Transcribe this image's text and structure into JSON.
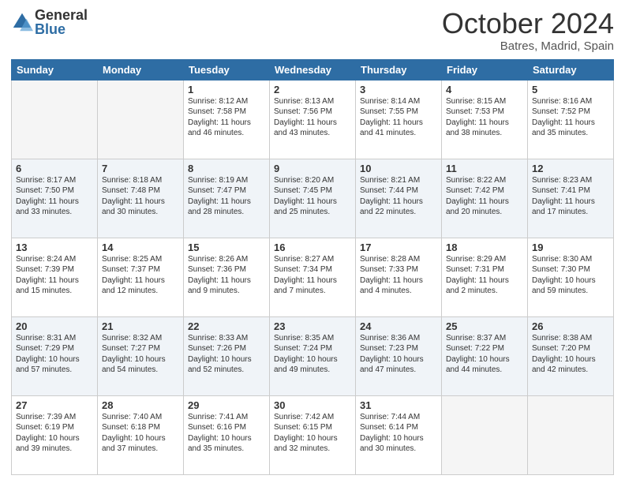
{
  "logo": {
    "general": "General",
    "blue": "Blue"
  },
  "header": {
    "month": "October 2024",
    "location": "Batres, Madrid, Spain"
  },
  "weekdays": [
    "Sunday",
    "Monday",
    "Tuesday",
    "Wednesday",
    "Thursday",
    "Friday",
    "Saturday"
  ],
  "weeks": [
    [
      {
        "day": "",
        "info": ""
      },
      {
        "day": "",
        "info": ""
      },
      {
        "day": "1",
        "info": "Sunrise: 8:12 AM\nSunset: 7:58 PM\nDaylight: 11 hours and 46 minutes."
      },
      {
        "day": "2",
        "info": "Sunrise: 8:13 AM\nSunset: 7:56 PM\nDaylight: 11 hours and 43 minutes."
      },
      {
        "day": "3",
        "info": "Sunrise: 8:14 AM\nSunset: 7:55 PM\nDaylight: 11 hours and 41 minutes."
      },
      {
        "day": "4",
        "info": "Sunrise: 8:15 AM\nSunset: 7:53 PM\nDaylight: 11 hours and 38 minutes."
      },
      {
        "day": "5",
        "info": "Sunrise: 8:16 AM\nSunset: 7:52 PM\nDaylight: 11 hours and 35 minutes."
      }
    ],
    [
      {
        "day": "6",
        "info": "Sunrise: 8:17 AM\nSunset: 7:50 PM\nDaylight: 11 hours and 33 minutes."
      },
      {
        "day": "7",
        "info": "Sunrise: 8:18 AM\nSunset: 7:48 PM\nDaylight: 11 hours and 30 minutes."
      },
      {
        "day": "8",
        "info": "Sunrise: 8:19 AM\nSunset: 7:47 PM\nDaylight: 11 hours and 28 minutes."
      },
      {
        "day": "9",
        "info": "Sunrise: 8:20 AM\nSunset: 7:45 PM\nDaylight: 11 hours and 25 minutes."
      },
      {
        "day": "10",
        "info": "Sunrise: 8:21 AM\nSunset: 7:44 PM\nDaylight: 11 hours and 22 minutes."
      },
      {
        "day": "11",
        "info": "Sunrise: 8:22 AM\nSunset: 7:42 PM\nDaylight: 11 hours and 20 minutes."
      },
      {
        "day": "12",
        "info": "Sunrise: 8:23 AM\nSunset: 7:41 PM\nDaylight: 11 hours and 17 minutes."
      }
    ],
    [
      {
        "day": "13",
        "info": "Sunrise: 8:24 AM\nSunset: 7:39 PM\nDaylight: 11 hours and 15 minutes."
      },
      {
        "day": "14",
        "info": "Sunrise: 8:25 AM\nSunset: 7:37 PM\nDaylight: 11 hours and 12 minutes."
      },
      {
        "day": "15",
        "info": "Sunrise: 8:26 AM\nSunset: 7:36 PM\nDaylight: 11 hours and 9 minutes."
      },
      {
        "day": "16",
        "info": "Sunrise: 8:27 AM\nSunset: 7:34 PM\nDaylight: 11 hours and 7 minutes."
      },
      {
        "day": "17",
        "info": "Sunrise: 8:28 AM\nSunset: 7:33 PM\nDaylight: 11 hours and 4 minutes."
      },
      {
        "day": "18",
        "info": "Sunrise: 8:29 AM\nSunset: 7:31 PM\nDaylight: 11 hours and 2 minutes."
      },
      {
        "day": "19",
        "info": "Sunrise: 8:30 AM\nSunset: 7:30 PM\nDaylight: 10 hours and 59 minutes."
      }
    ],
    [
      {
        "day": "20",
        "info": "Sunrise: 8:31 AM\nSunset: 7:29 PM\nDaylight: 10 hours and 57 minutes."
      },
      {
        "day": "21",
        "info": "Sunrise: 8:32 AM\nSunset: 7:27 PM\nDaylight: 10 hours and 54 minutes."
      },
      {
        "day": "22",
        "info": "Sunrise: 8:33 AM\nSunset: 7:26 PM\nDaylight: 10 hours and 52 minutes."
      },
      {
        "day": "23",
        "info": "Sunrise: 8:35 AM\nSunset: 7:24 PM\nDaylight: 10 hours and 49 minutes."
      },
      {
        "day": "24",
        "info": "Sunrise: 8:36 AM\nSunset: 7:23 PM\nDaylight: 10 hours and 47 minutes."
      },
      {
        "day": "25",
        "info": "Sunrise: 8:37 AM\nSunset: 7:22 PM\nDaylight: 10 hours and 44 minutes."
      },
      {
        "day": "26",
        "info": "Sunrise: 8:38 AM\nSunset: 7:20 PM\nDaylight: 10 hours and 42 minutes."
      }
    ],
    [
      {
        "day": "27",
        "info": "Sunrise: 7:39 AM\nSunset: 6:19 PM\nDaylight: 10 hours and 39 minutes."
      },
      {
        "day": "28",
        "info": "Sunrise: 7:40 AM\nSunset: 6:18 PM\nDaylight: 10 hours and 37 minutes."
      },
      {
        "day": "29",
        "info": "Sunrise: 7:41 AM\nSunset: 6:16 PM\nDaylight: 10 hours and 35 minutes."
      },
      {
        "day": "30",
        "info": "Sunrise: 7:42 AM\nSunset: 6:15 PM\nDaylight: 10 hours and 32 minutes."
      },
      {
        "day": "31",
        "info": "Sunrise: 7:44 AM\nSunset: 6:14 PM\nDaylight: 10 hours and 30 minutes."
      },
      {
        "day": "",
        "info": ""
      },
      {
        "day": "",
        "info": ""
      }
    ]
  ]
}
